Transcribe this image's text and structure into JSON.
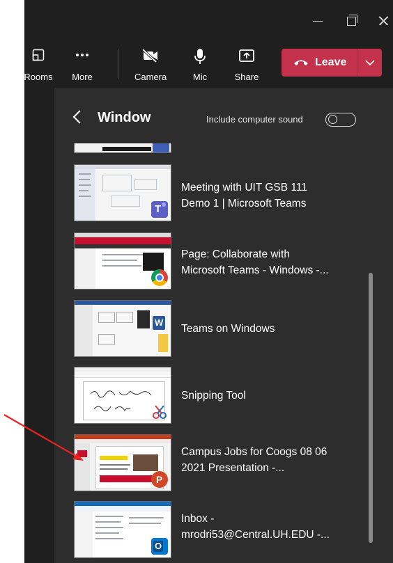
{
  "toolbar": {
    "rooms_label": "Rooms",
    "more_label": "More",
    "camera_label": "Camera",
    "mic_label": "Mic",
    "share_label": "Share",
    "leave_label": "Leave"
  },
  "panel": {
    "title": "Window",
    "sound_label": "Include computer sound",
    "sound_on": false
  },
  "windows": [
    {
      "title_line1": "Meeting with UIT GSB 111",
      "title_line2": "Demo 1 | Microsoft Teams",
      "app": "teams-icon"
    },
    {
      "title_line1": "Page: Collaborate with",
      "title_line2": "Microsoft Teams - Windows -...",
      "app": "chrome-icon"
    },
    {
      "title_line1": "Teams on Windows",
      "title_line2": "",
      "app": "word-icon"
    },
    {
      "title_line1": "Snipping Tool",
      "title_line2": "",
      "app": "snipping-tool-icon"
    },
    {
      "title_line1": "Campus Jobs for Coogs 08 06",
      "title_line2": "2021 Presentation -...",
      "app": "powerpoint-icon"
    },
    {
      "title_line1": "Inbox -",
      "title_line2": "mrodri53@Central.UH.EDU -...",
      "app": "outlook-icon"
    }
  ],
  "colors": {
    "leave": "#c4314b",
    "background": "#1f1f1f",
    "panel": "#2d2d2d",
    "annotation_arrow": "#e8231f"
  }
}
